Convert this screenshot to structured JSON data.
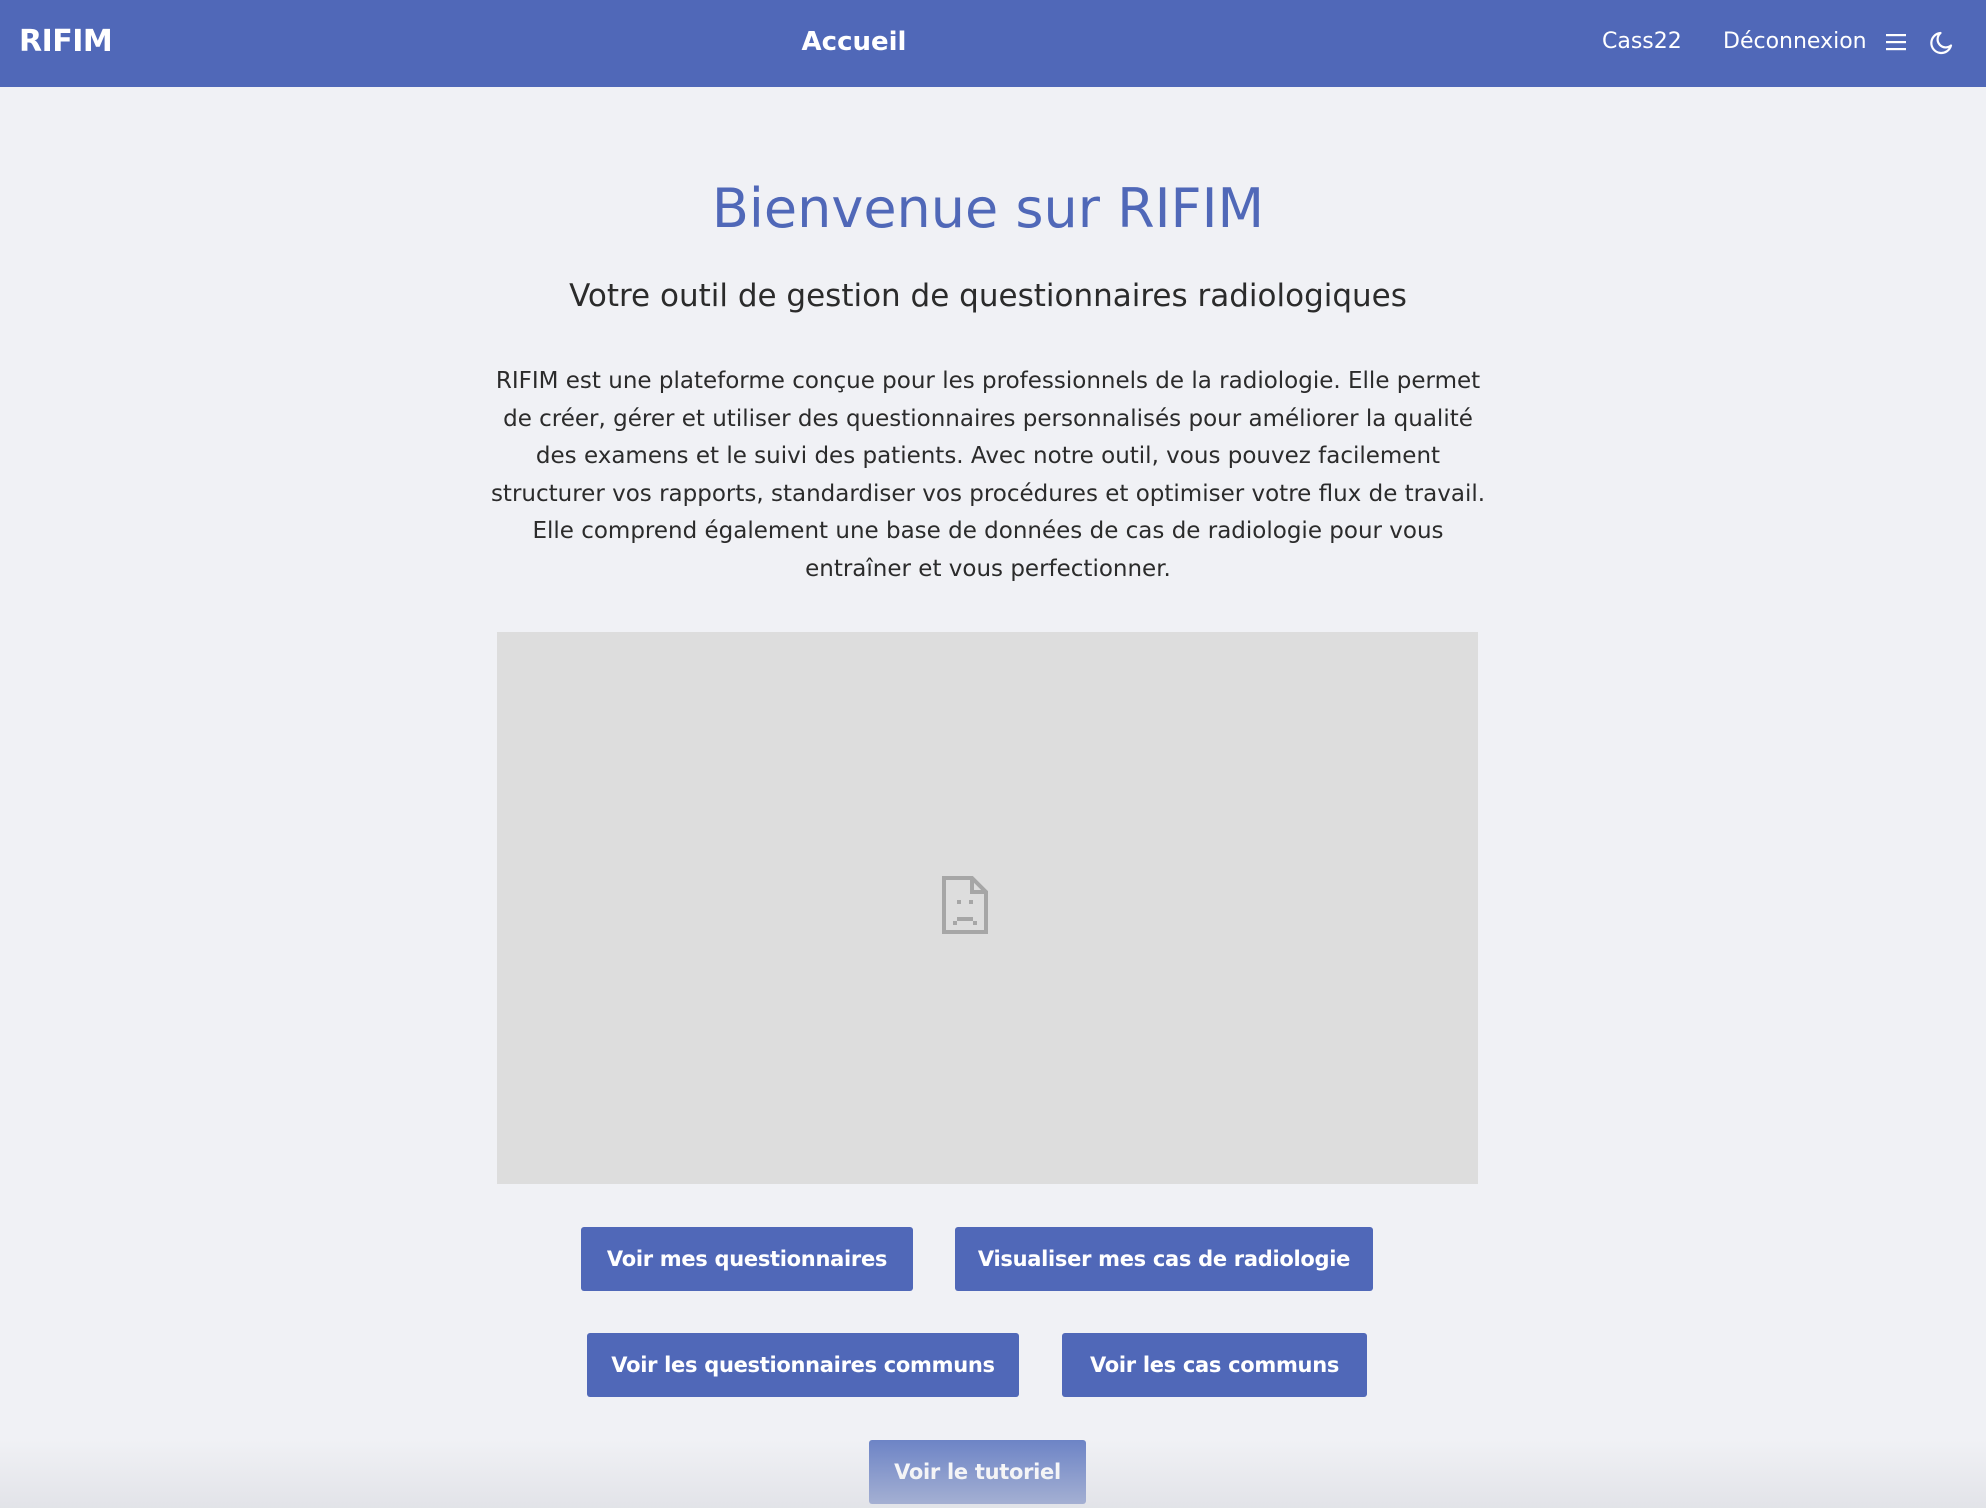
{
  "navbar": {
    "brand": "RIFIM",
    "title": "Accueil",
    "user": "Cass22",
    "logout_label": "Déconnexion",
    "menu_icon": "hamburger-menu-icon",
    "theme_icon": "moon-icon",
    "background_color": "#5068b8"
  },
  "hero": {
    "title": "Bienvenue sur RIFIM",
    "subtitle": "Votre outil de gestion de questionnaires radiologiques",
    "description": "RIFIM est une plateforme conçue pour les professionnels de la radiologie. Elle permet de créer, gérer et utiliser des questionnaires personnalisés pour améliorer la qualité des examens et le suivi des patients. Avec notre outil, vous pouvez facilement structurer vos rapports, standardiser vos procédures et optimiser votre flux de travail. Elle comprend également une base de données de cas de radiologie pour vous entraîner et vous perfectionner."
  },
  "embed": {
    "icon": "broken-document-icon"
  },
  "actions": {
    "my_questionnaires": "Voir mes questionnaires",
    "my_cases": "Visualiser mes cas de radiologie",
    "common_questionnaires": "Voir les questionnaires communs",
    "common_cases": "Voir les cas communs",
    "tutorial": "Voir le tutoriel"
  },
  "colors": {
    "accent": "#5068b8",
    "page_background": "#f0f1f5",
    "embed_placeholder": "#dddddd"
  }
}
